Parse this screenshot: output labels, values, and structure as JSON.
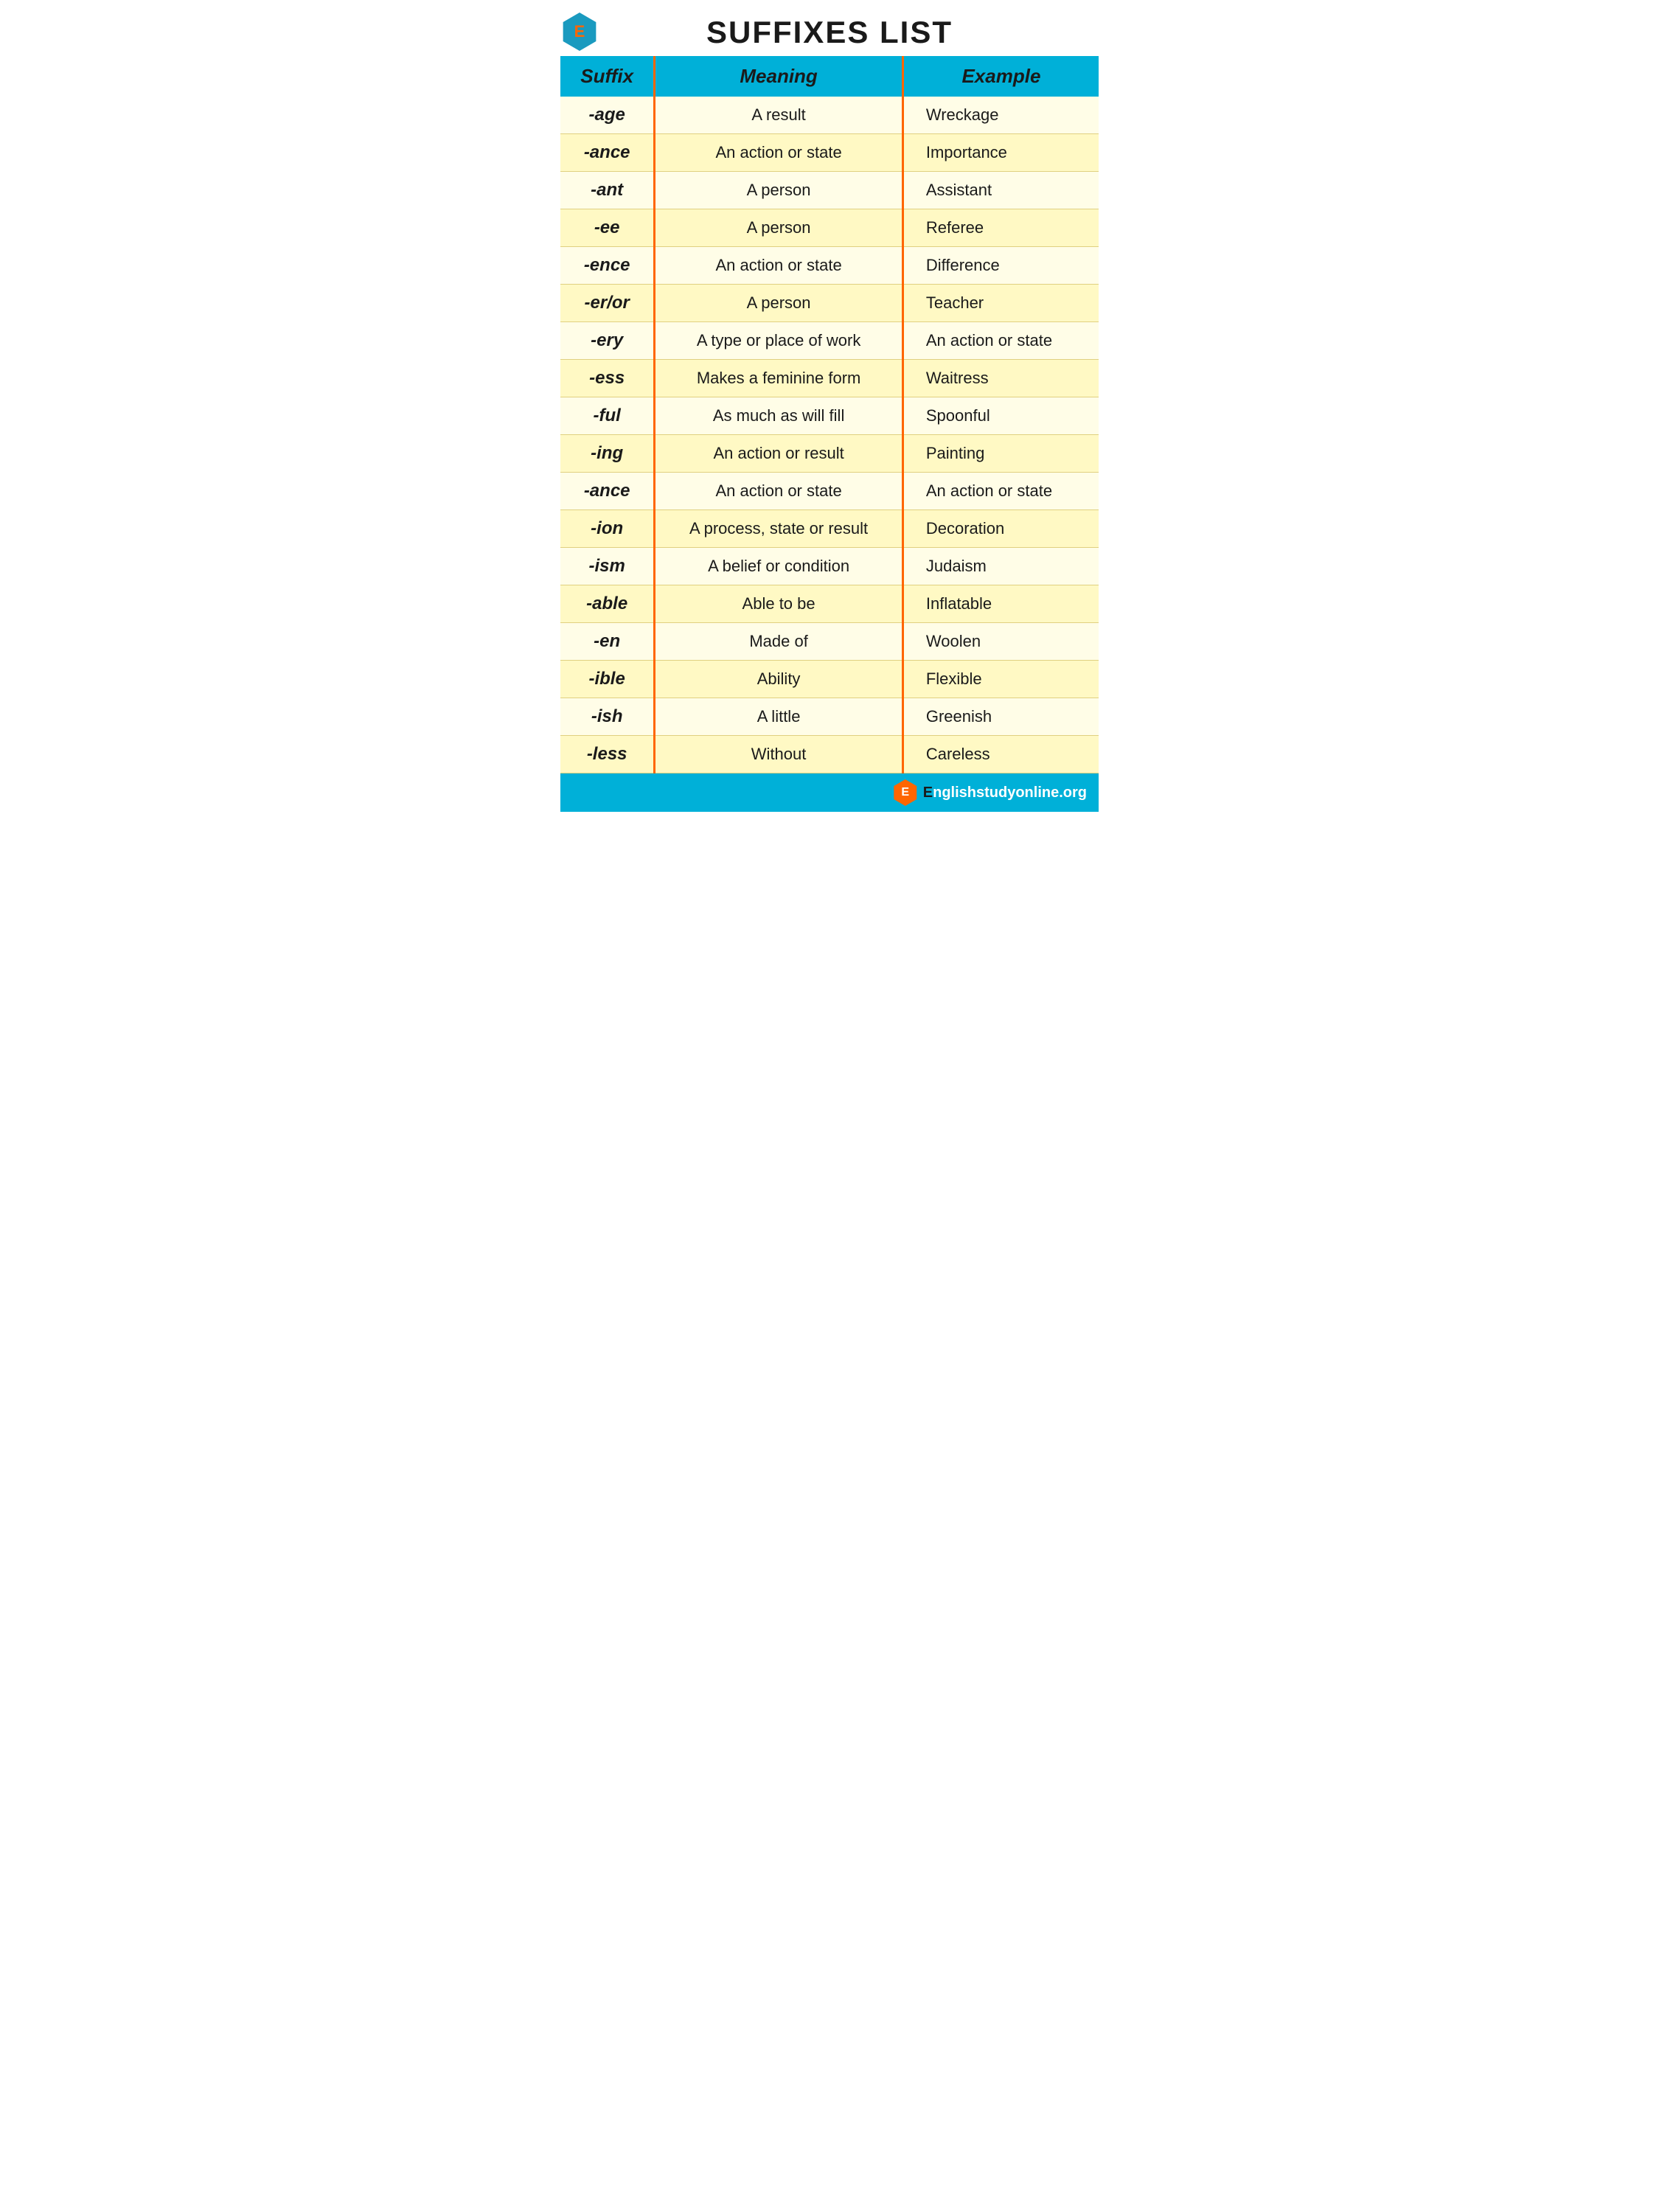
{
  "page": {
    "title": "SUFFIXES LIST",
    "logo_letter": "E",
    "footer_url": "Englishstudyonline.org"
  },
  "table": {
    "headers": [
      "Suffix",
      "Meaning",
      "Example"
    ],
    "rows": [
      {
        "suffix": "-age",
        "meaning": "A result",
        "example": "Wreckage"
      },
      {
        "suffix": "-ance",
        "meaning": "An action or state",
        "example": "Importance"
      },
      {
        "suffix": "-ant",
        "meaning": "A person",
        "example": "Assistant"
      },
      {
        "suffix": "-ee",
        "meaning": "A person",
        "example": "Referee"
      },
      {
        "suffix": "-ence",
        "meaning": "An action or state",
        "example": "Difference"
      },
      {
        "suffix": "-er/or",
        "meaning": "A person",
        "example": "Teacher"
      },
      {
        "suffix": "-ery",
        "meaning": "A type or place of work",
        "example": "An action or state"
      },
      {
        "suffix": "-ess",
        "meaning": "Makes a feminine form",
        "example": "Waitress"
      },
      {
        "suffix": "-ful",
        "meaning": "As much as will fill",
        "example": "Spoonful"
      },
      {
        "suffix": "-ing",
        "meaning": "An action or result",
        "example": "Painting"
      },
      {
        "suffix": "-ance",
        "meaning": "An action or state",
        "example": "An action or state"
      },
      {
        "suffix": "-ion",
        "meaning": "A process, state or result",
        "example": "Decoration"
      },
      {
        "suffix": "-ism",
        "meaning": "A belief or condition",
        "example": "Judaism"
      },
      {
        "suffix": "-able",
        "meaning": "Able to be",
        "example": "Inflatable"
      },
      {
        "suffix": "-en",
        "meaning": "Made of",
        "example": "Woolen"
      },
      {
        "suffix": "-ible",
        "meaning": "Ability",
        "example": "Flexible"
      },
      {
        "suffix": "-ish",
        "meaning": "A little",
        "example": "Greenish"
      },
      {
        "suffix": "-less",
        "meaning": "Without",
        "example": "Careless"
      }
    ]
  }
}
